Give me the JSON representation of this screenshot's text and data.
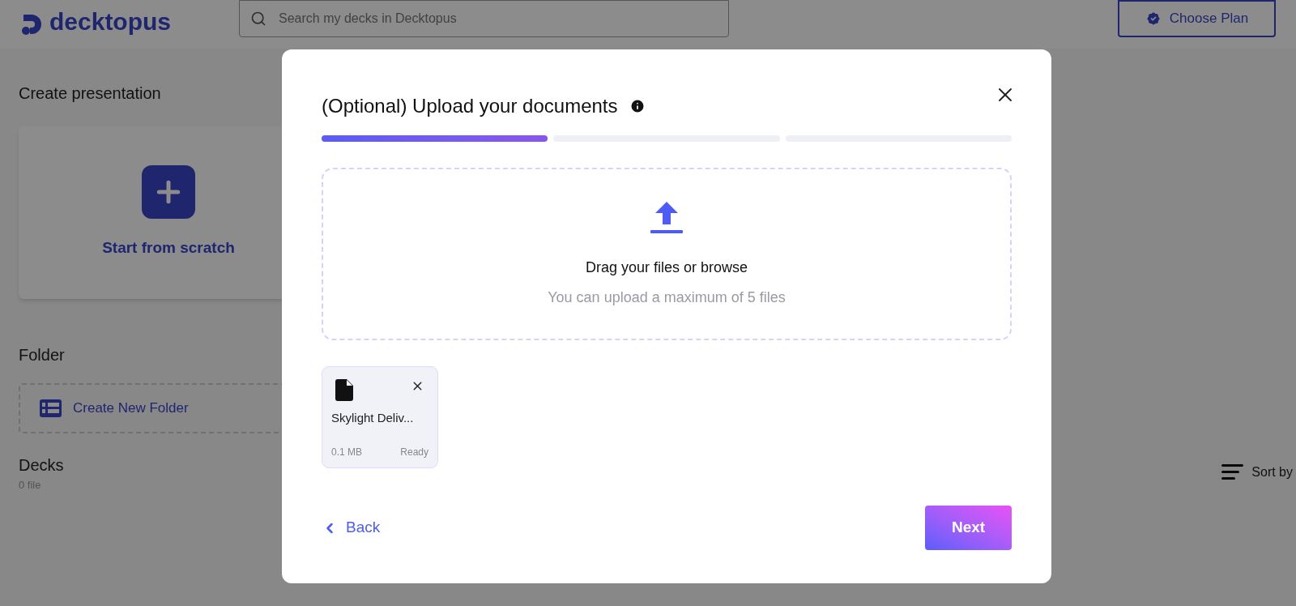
{
  "header": {
    "logo": "decktopus",
    "search": {
      "placeholder": "Search my decks in Decktopus"
    },
    "plan_button": "Choose Plan"
  },
  "create_section": {
    "title": "Create presentation",
    "card_label": "Start from scratch"
  },
  "folder_section": {
    "title": "Folder",
    "create_label": "Create New Folder"
  },
  "decks_section": {
    "title": "Decks",
    "count": "0 file",
    "sort_label": "Sort by"
  },
  "modal": {
    "title": "(Optional) Upload your documents",
    "steps": [
      {
        "done": true
      },
      {
        "done": false
      },
      {
        "done": false
      }
    ],
    "dropzone": {
      "title": "Drag your files or browse",
      "hint": "You can upload a maximum of 5 files"
    },
    "files": [
      {
        "name": "Skylight Deliv...",
        "size": "0.1 MB",
        "status": "Ready"
      }
    ],
    "back": "Back",
    "next": "Next"
  }
}
